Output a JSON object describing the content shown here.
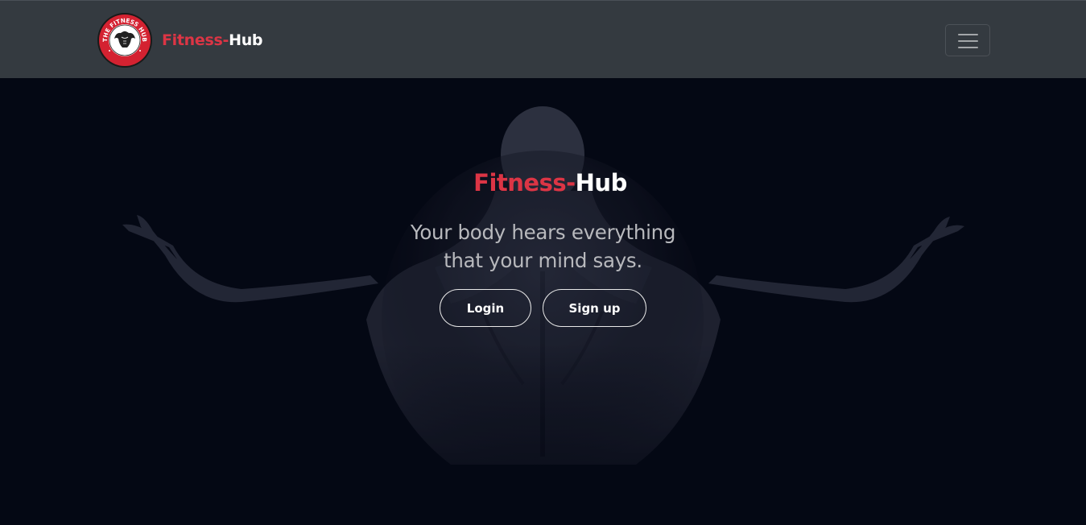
{
  "brand": {
    "name_part1": "Fitness-",
    "name_part2": "Hub",
    "logo_top_text": "THE FITNESS HUB",
    "logo_bottom_text": "GYM"
  },
  "navbar": {
    "toggler_icon": "hamburger-icon"
  },
  "hero": {
    "title_part1": "Fitness-",
    "title_part2": "Hub",
    "tagline_line1": "Your body hears everything",
    "tagline_line2": "that your mind says.",
    "login_label": "Login",
    "signup_label": "Sign up"
  },
  "colors": {
    "accent": "#dc3545",
    "navbar_bg": "#343a40",
    "hero_bg": "#050814",
    "text_light": "#ffffff",
    "tagline": "#b8b9bd"
  }
}
